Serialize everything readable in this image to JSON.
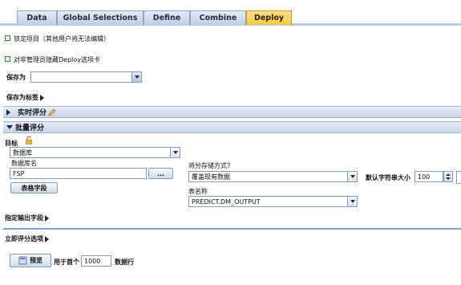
{
  "tabs": [
    {
      "label": "Data"
    },
    {
      "label": "Global Selections"
    },
    {
      "label": "Define"
    },
    {
      "label": "Combine"
    },
    {
      "label": "Deploy"
    }
  ],
  "lock_items_label": "锁定项目（其他用户将无法编辑）",
  "hide_deploy_tab_label": "对非管理员隐藏Deploy选项卡",
  "save_as": {
    "label": "保存为",
    "value": ""
  },
  "save_as_tag_label": "保存为标签",
  "realtime_section": {
    "title": "实时评分"
  },
  "batch_section": {
    "title": "批量评分"
  },
  "target": {
    "label": "目标",
    "selected": "数据库",
    "db_name_label": "数据库名",
    "db_name_value": "FSP",
    "browse_label": "...",
    "table_fields_button": "表格字段"
  },
  "storage": {
    "label": "将分存储方式?",
    "selected": "覆盖现有数据",
    "default_string_size_label": "默认字符串大小",
    "default_string_size_value": "100",
    "table_name_label": "表名称",
    "table_name_value": "PREDICT.DM_OUTPUT"
  },
  "output_fields_label": "指定输出字段",
  "immediate_scoring": {
    "title": "立即评分选项",
    "preview_button": "预览",
    "for_first_label": "用于首个",
    "rows_value": "1000",
    "rows_suffix": "数据行"
  },
  "colors": {
    "accent": "#f7c843",
    "tab_blue": "#bccfe6",
    "line_blue": "#7c9cc8"
  }
}
